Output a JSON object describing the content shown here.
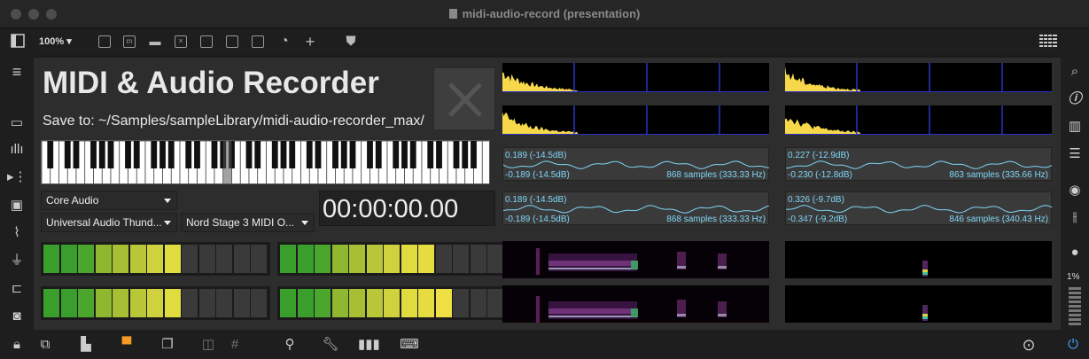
{
  "window": {
    "title": "midi-audio-record (presentation)"
  },
  "toolbar": {
    "zoom": "100%"
  },
  "app": {
    "title": "MIDI & Audio Recorder",
    "save_to": "Save to: ~/Samples/sampleLibrary/midi-audio-recorder_max/",
    "driver": "Core Audio",
    "audio_device": "Universal Audio Thund...",
    "midi_device": "Nord Stage 3 MIDI O...",
    "time": "00:00:00.00"
  },
  "meters": [
    {
      "lit": 8,
      "total": 13
    },
    {
      "lit": 9,
      "total": 13
    },
    {
      "lit": 8,
      "total": 13
    },
    {
      "lit": 10,
      "total": 13
    }
  ],
  "oscilloscopes": [
    {
      "top": "0.189 (-14.5dB)",
      "bottom": "-0.189 (-14.5dB)",
      "info": "868 samples (333.33 Hz)"
    },
    {
      "top": "0.227 (-12.9dB)",
      "bottom": "-0.230 (-12.8dB)",
      "info": "863 samples (335.66 Hz)"
    },
    {
      "top": "0.189 (-14.5dB)",
      "bottom": "-0.189 (-14.5dB)",
      "info": "868 samples (333.33 Hz)"
    },
    {
      "top": "0.326 (-9.7dB)",
      "bottom": "-0.347 (-9.2dB)",
      "info": "846 samples (340.43 Hz)"
    }
  ],
  "rightbar": {
    "percent": "1%"
  },
  "colors": {
    "canvas": "#2d2d2d",
    "waveform": "#f7d84a",
    "scope": "#7fd6f7",
    "accent_orange": "#f59a23",
    "power": "#3ea0ff"
  }
}
